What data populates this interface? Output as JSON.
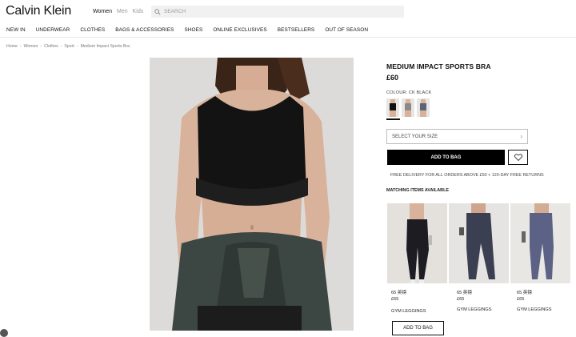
{
  "header": {
    "logo": "Calvin Klein",
    "gender_tabs": [
      "Women",
      "Men",
      "Kids"
    ],
    "search_placeholder": "SEARCH"
  },
  "nav": {
    "items": [
      "NEW IN",
      "UNDERWEAR",
      "CLOTHES",
      "BAGS & ACCESSORIES",
      "SHOES",
      "ONLINE EXCLUSIVES",
      "BESTSELLERS",
      "OUT OF SEASON"
    ]
  },
  "breadcrumb": [
    "Home",
    "Women",
    "Clothes",
    "Sport",
    "Medium Impact Sports Bra"
  ],
  "product": {
    "name": "MEDIUM IMPACT SPORTS BRA",
    "price": "£60",
    "colour_label": "COLOUR: CK BLACK",
    "swatches": [
      {
        "name": "black",
        "color": "#111111"
      },
      {
        "name": "grey",
        "color": "#8c8a88"
      },
      {
        "name": "slate",
        "color": "#5d6476"
      }
    ],
    "size_placeholder": "SELECT YOUR SIZE",
    "add_to_bag": "ADD TO BAG",
    "delivery": "FREE DELIVERY FOR ALL ORDERS ABOVE £50 + 120-DAY FREE RETURNS"
  },
  "matching": {
    "title": "MATCHING ITEMS AVAILABLE",
    "items": [
      {
        "code": "65 英镑",
        "price": "£65",
        "name": "GYM LEGGINGS",
        "color": "#1c1c22"
      },
      {
        "code": "65 英镑",
        "price": "£65",
        "name": "GYM LEGGINGS",
        "color": "#3a3f52"
      },
      {
        "code": "65 英镑",
        "price": "£65",
        "name": "GYM LEGGINGS",
        "color": "#5b6285"
      }
    ],
    "add_to_bag": "ADD TO BAG"
  },
  "colors": {
    "accent": "#000000",
    "bra": "#131313",
    "jacket": "#3c4642",
    "skin": "#d9b39b",
    "background": "#d9d8d6"
  }
}
